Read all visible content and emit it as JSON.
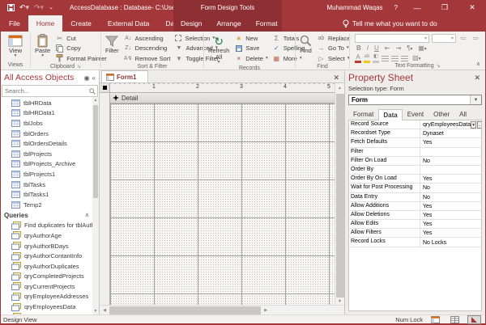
{
  "titlebar": {
    "title": "AccessDatabase : Database- C:\\Users\\Mu...",
    "contextual": "Form Design Tools",
    "user": "Muhammad Waqas",
    "help": "?",
    "minimize": "—",
    "maximize": "❒",
    "close": "✕"
  },
  "tabs": {
    "file": "File",
    "home": "Home",
    "create": "Create",
    "external_data": "External Data",
    "database_tools": "Database Tools",
    "design": "Design",
    "arrange": "Arrange",
    "format": "Format",
    "tell_me": "Tell me what you want to do"
  },
  "ribbon": {
    "view": "View",
    "views_group": "Views",
    "paste": "Paste",
    "cut": "Cut",
    "copy": "Copy",
    "format_painter": "Format Painter",
    "clipboard_group": "Clipboard",
    "filter": "Filter",
    "ascending": "Ascending",
    "descending": "Descending",
    "remove_sort": "Remove Sort",
    "selection": "Selection",
    "advanced": "Advanced",
    "toggle_filter": "Toggle Filter",
    "sort_filter_group": "Sort & Filter",
    "refresh_all": "Refresh All",
    "new": "New",
    "save": "Save",
    "delete": "Delete",
    "totals": "Totals",
    "spelling": "Spelling",
    "more": "More",
    "records_group": "Records",
    "find": "Find",
    "replace": "Replace",
    "go_to": "Go To",
    "select": "Select",
    "find_group": "Find",
    "bold": "B",
    "italic": "I",
    "underline": "U",
    "font_color": "A",
    "highlight": "ab",
    "text_formatting_group": "Text Formatting"
  },
  "nav": {
    "title": "All Access Objects",
    "search_placeholder": "Search...",
    "tables": [
      "tblHRData",
      "tblHRData1",
      "tblJobs",
      "tblOrders",
      "tblOrdersDetails",
      "tblProjects",
      "tblProjects_Archive",
      "tblProjects1",
      "tblTasks",
      "tblTasks1",
      "Temp2"
    ],
    "queries_header": "Queries",
    "queries": [
      "Find duplicates for tblAuthors",
      "qryAuthorAge",
      "qryAuthorBDays",
      "qryAuthorContantInfo",
      "qryAuthorDuplicates",
      "qryCompletedProjects",
      "qryCurrentProjects",
      "qryEmployeeAddresses",
      "qryEmployeesData"
    ]
  },
  "doc": {
    "tab": "Form1",
    "close": "✕",
    "section": "Detail",
    "ruler": [
      "1",
      "2",
      "3",
      "4",
      "5"
    ]
  },
  "props": {
    "title": "Property Sheet",
    "close": "✕",
    "selection_label": "Selection type:  Form",
    "selector": "Form",
    "tabs": {
      "format": "Format",
      "data": "Data",
      "event": "Event",
      "other": "Other",
      "all": "All"
    },
    "rows": [
      {
        "name": "Record Source",
        "value": "qryEmployeesData"
      },
      {
        "name": "Recordset Type",
        "value": "Dynaset"
      },
      {
        "name": "Fetch Defaults",
        "value": "Yes"
      },
      {
        "name": "Filter",
        "value": ""
      },
      {
        "name": "Filter On Load",
        "value": "No"
      },
      {
        "name": "Order By",
        "value": ""
      },
      {
        "name": "Order By On Load",
        "value": "Yes"
      },
      {
        "name": "Wait for Post Processing",
        "value": "No"
      },
      {
        "name": "Data Entry",
        "value": "No"
      },
      {
        "name": "Allow Additions",
        "value": "Yes"
      },
      {
        "name": "Allow Deletions",
        "value": "Yes"
      },
      {
        "name": "Allow Edits",
        "value": "Yes"
      },
      {
        "name": "Allow Filters",
        "value": "Yes"
      },
      {
        "name": "Record Locks",
        "value": "No Locks"
      }
    ]
  },
  "status": {
    "left": "Design View",
    "num_lock": "Num Lock"
  },
  "colors": {
    "accent": "#A4373A",
    "contextual": "#8E2F33"
  }
}
